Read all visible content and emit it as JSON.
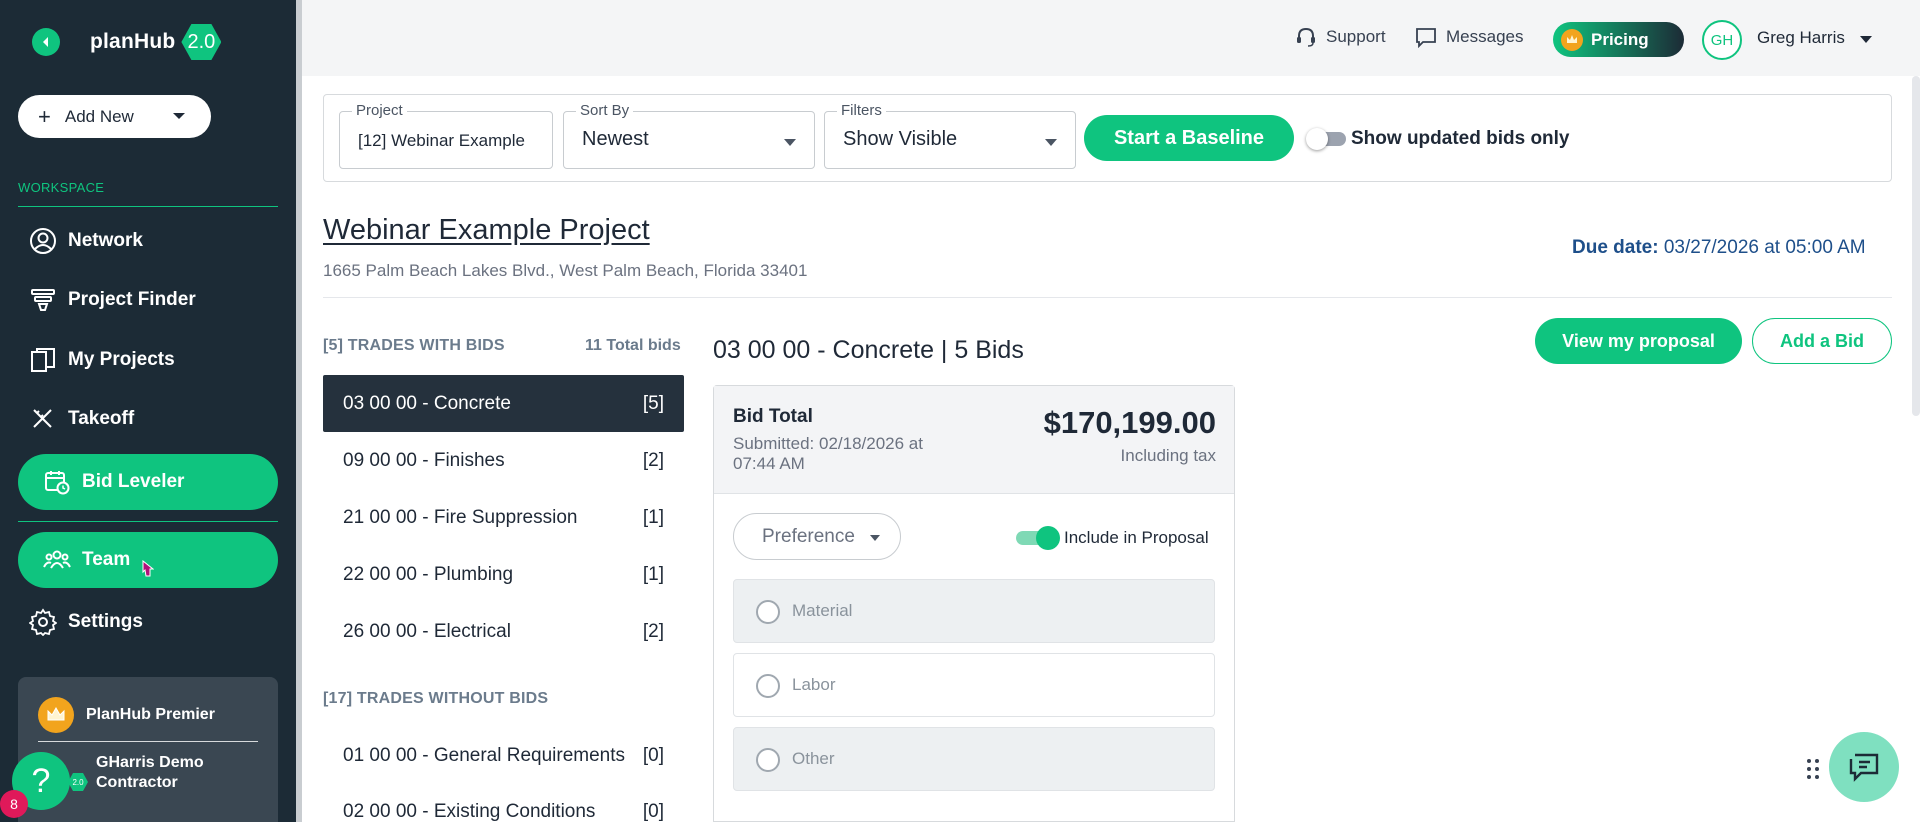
{
  "app": {
    "brand": "planHub",
    "brand_version": "2.0"
  },
  "sidebar": {
    "add_new_label": "Add New",
    "workspace_label": "WORKSPACE",
    "items": [
      {
        "label": "Network",
        "icon": "user-circle-icon"
      },
      {
        "label": "Project Finder",
        "icon": "filter-icon"
      },
      {
        "label": "My Projects",
        "icon": "documents-icon"
      },
      {
        "label": "Takeoff",
        "icon": "ruler-pencil-icon"
      },
      {
        "label": "Bid Leveler",
        "icon": "calendar-clock-icon"
      },
      {
        "label": "Team",
        "icon": "team-icon"
      },
      {
        "label": "Settings",
        "icon": "gear-icon"
      }
    ],
    "premier_label": "PlanHub Premier",
    "company_name": "GHarris Demo Contractor",
    "mini_badge": "2.0",
    "help_badge_count": "8"
  },
  "header": {
    "support_label": "Support",
    "messages_label": "Messages",
    "pricing_label": "Pricing",
    "user_initials": "GH",
    "user_name": "Greg Harris"
  },
  "filters": {
    "project_label": "Project",
    "project_value": "[12] Webinar Example",
    "sort_label": "Sort By",
    "sort_value": "Newest",
    "filters_label": "Filters",
    "filters_value": "Show Visible",
    "baseline_label": "Start a Baseline",
    "updated_only_label": "Show updated bids only"
  },
  "project": {
    "title": "Webinar Example Project",
    "address": "1665 Palm Beach Lakes Blvd., West Palm Beach, Florida 33401",
    "due_label": "Due date:",
    "due_value": "03/27/2026 at 05:00 AM"
  },
  "trades": {
    "with_bids_label": "[5] TRADES WITH BIDS",
    "total_bids_label": "11 Total bids",
    "with_bids": [
      {
        "name": "03 00 00 - Concrete",
        "count": "[5]"
      },
      {
        "name": "09 00 00 - Finishes",
        "count": "[2]"
      },
      {
        "name": "21 00 00 - Fire Suppression",
        "count": "[1]"
      },
      {
        "name": "22 00 00 - Plumbing",
        "count": "[1]"
      },
      {
        "name": "26 00 00 - Electrical",
        "count": "[2]"
      }
    ],
    "without_bids_label": "[17] TRADES WITHOUT BIDS",
    "without_bids": [
      {
        "name": "01 00 00 - General Requirements",
        "count": "[0]"
      },
      {
        "name": "02 00 00 - Existing Conditions",
        "count": "[0]"
      }
    ]
  },
  "bids": {
    "title": "03 00 00 - Concrete | 5 Bids",
    "view_proposal_label": "View my proposal",
    "add_bid_label": "Add a Bid",
    "card": {
      "total_label": "Bid Total",
      "submitted": "Submitted: 02/18/2026 at 07:44 AM",
      "amount": "$170,199.00",
      "tax_note": "Including tax",
      "preference_label": "Preference",
      "include_label": "Include in Proposal",
      "options": [
        "Material",
        "Labor",
        "Other"
      ]
    }
  },
  "colors": {
    "accent": "#0fc47f",
    "sidebar": "#1c2b36",
    "selected_trade": "#25313d",
    "due_blue": "#1e4f8a"
  }
}
